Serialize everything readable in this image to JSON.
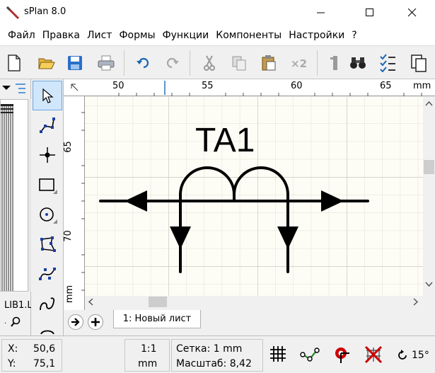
{
  "window": {
    "title": "sPlan 8.0"
  },
  "menu": [
    "Файл",
    "Правка",
    "Лист",
    "Формы",
    "Функции",
    "Компоненты",
    "Настройки",
    "?"
  ],
  "library": {
    "name": "LIB1.L"
  },
  "ruler": {
    "top_ticks": [
      "50",
      "55",
      "60",
      "65"
    ],
    "top_unit": "mm",
    "left_ticks": [
      "65",
      "70"
    ],
    "left_unit": "mm"
  },
  "canvas": {
    "component_label": "TA1",
    "background": "#fdfdf5",
    "grid_color": "#dddddd"
  },
  "sheets": {
    "tab_label": "1: Новый лист"
  },
  "status": {
    "x_label": "X:",
    "x_value": "50,6",
    "y_label": "Y:",
    "y_value": "75,1",
    "scale_ratio": "1:1",
    "unit": "mm",
    "grid": "Сетка: 1 mm",
    "zoom": "Масштаб: 8,42",
    "angle": "15°"
  },
  "colors": {
    "accent": "#1a66b5",
    "snap_red": "#cc0000",
    "snap_green": "#2e8b2e"
  }
}
